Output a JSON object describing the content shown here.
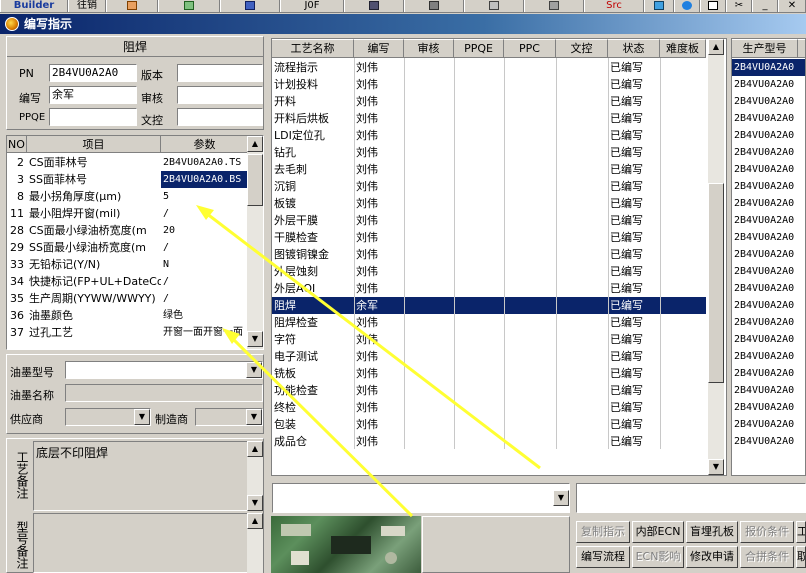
{
  "toolbar": {
    "items": [
      "Builder",
      "往销",
      "",
      "",
      "",
      "J0F",
      "",
      "",
      "",
      "",
      "",
      "Src",
      "",
      "",
      "",
      "",
      ""
    ]
  },
  "window": {
    "title": "编写指示"
  },
  "solder_group": {
    "title": "阻焊",
    "pn_label": "PN",
    "pn_value": "2B4VU0A2A0",
    "version_label": "版本",
    "version_value": "",
    "author_label": "编写",
    "author_value": "余军",
    "review_label": "审核",
    "review_value": "",
    "ppqe_label": "PPQE",
    "ppqe_value": "",
    "doc_label": "文控",
    "doc_value": ""
  },
  "param_table": {
    "headers": [
      "NO",
      "项目",
      "参数"
    ],
    "rows": [
      {
        "no": "2",
        "item": "CS面菲林号",
        "value": "2B4VU0A2A0.TS"
      },
      {
        "no": "3",
        "item": "SS面菲林号",
        "value": "2B4VU0A2A0.BS"
      },
      {
        "no": "8",
        "item": "最小拐角厚度(μm)",
        "value": "5"
      },
      {
        "no": "11",
        "item": "最小阻焊开窗(mil)",
        "value": "/"
      },
      {
        "no": "28",
        "item": "CS面最小绿油桥宽度(m",
        "value": "20"
      },
      {
        "no": "29",
        "item": "SS面最小绿油桥宽度(m",
        "value": "/"
      },
      {
        "no": "33",
        "item": "无铅标记(Y/N)",
        "value": "N"
      },
      {
        "no": "34",
        "item": "快捷标记(FP+UL+DateCo",
        "value": "/"
      },
      {
        "no": "35",
        "item": "生产周期(YYWW/WWYY)",
        "value": "/"
      },
      {
        "no": "36",
        "item": "油墨颜色",
        "value": "绿色"
      },
      {
        "no": "37",
        "item": "过孔工艺",
        "value": "开窗一面开窗一面"
      }
    ]
  },
  "ink": {
    "model_label": "油墨型号",
    "model_value": "",
    "name_label": "油墨名称",
    "name_value": "",
    "supplier_label": "供应商",
    "supplier_value": "",
    "maker_label": "制造商",
    "maker_value": ""
  },
  "remarks": {
    "process_label": "工艺备注",
    "process_value": "底层不印阻焊",
    "model_label": "型号备注",
    "model_value": ""
  },
  "process_table": {
    "headers": [
      "工艺名称",
      "编写",
      "审核",
      "PPQE",
      "PPC",
      "文控",
      "状态",
      "难度板"
    ],
    "rows": [
      {
        "name": "流程指示",
        "author": "刘伟",
        "status": "已编写"
      },
      {
        "name": "计划投料",
        "author": "刘伟",
        "status": "已编写"
      },
      {
        "name": "开料",
        "author": "刘伟",
        "status": "已编写"
      },
      {
        "name": "开料后烘板",
        "author": "刘伟",
        "status": "已编写"
      },
      {
        "name": "LDI定位孔",
        "author": "刘伟",
        "status": "已编写"
      },
      {
        "name": "钻孔",
        "author": "刘伟",
        "status": "已编写"
      },
      {
        "name": "去毛刺",
        "author": "刘伟",
        "status": "已编写"
      },
      {
        "name": "沉铜",
        "author": "刘伟",
        "status": "已编写"
      },
      {
        "name": "板镀",
        "author": "刘伟",
        "status": "已编写"
      },
      {
        "name": "外层干膜",
        "author": "刘伟",
        "status": "已编写"
      },
      {
        "name": "干膜检查",
        "author": "刘伟",
        "status": "已编写"
      },
      {
        "name": "图镀铜镍金",
        "author": "刘伟",
        "status": "已编写"
      },
      {
        "name": "外层蚀刻",
        "author": "刘伟",
        "status": "已编写"
      },
      {
        "name": "外层AOI",
        "author": "刘伟",
        "status": "已编写"
      },
      {
        "name": "阻焊",
        "author": "余军",
        "status": "已编写"
      },
      {
        "name": "阻焊检查",
        "author": "刘伟",
        "status": "已编写"
      },
      {
        "name": "字符",
        "author": "刘伟",
        "status": "已编写"
      },
      {
        "name": "电子测试",
        "author": "刘伟",
        "status": "已编写"
      },
      {
        "name": "铣板",
        "author": "刘伟",
        "status": "已编写"
      },
      {
        "name": "功能检查",
        "author": "刘伟",
        "status": "已编写"
      },
      {
        "name": "终检",
        "author": "刘伟",
        "status": "已编写"
      },
      {
        "name": "包装",
        "author": "刘伟",
        "status": "已编写"
      },
      {
        "name": "成品仓",
        "author": "刘伟",
        "status": "已编写"
      }
    ]
  },
  "model_list": {
    "header": "生产型号",
    "items": [
      "2B4VU0A2A0",
      "2B4VU0A2A0",
      "2B4VU0A2A0",
      "2B4VU0A2A0",
      "2B4VU0A2A0",
      "2B4VU0A2A0",
      "2B4VU0A2A0",
      "2B4VU0A2A0",
      "2B4VU0A2A0",
      "2B4VU0A2A0",
      "2B4VU0A2A0",
      "2B4VU0A2A0",
      "2B4VU0A2A0",
      "2B4VU0A2A0",
      "2B4VU0A2A0",
      "2B4VU0A2A0",
      "2B4VU0A2A0",
      "2B4VU0A2A0",
      "2B4VU0A2A0",
      "2B4VU0A2A0",
      "2B4VU0A2A0",
      "2B4VU0A2A0",
      "2B4VU0A2A0"
    ]
  },
  "buttons": {
    "copy": "复制指示",
    "internal_ecn": "内部ECN",
    "blind_hole": "盲埋孔板",
    "quote": "报价条件",
    "edit_flow": "编写流程",
    "ecn_impact": "ECN影响",
    "modify_apply": "修改申请",
    "merge_cond": "合拼条件",
    "extra1": "工",
    "extra2": "取"
  }
}
